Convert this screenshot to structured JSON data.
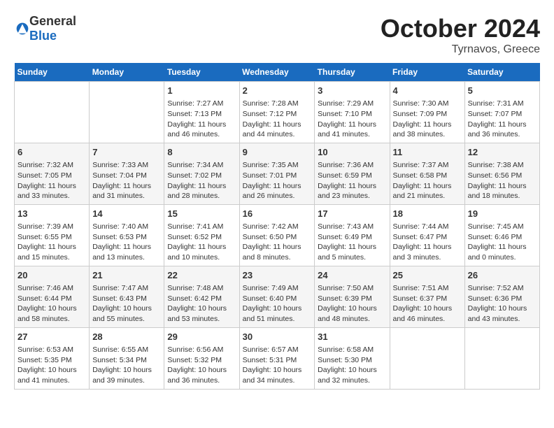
{
  "header": {
    "logo_general": "General",
    "logo_blue": "Blue",
    "month": "October 2024",
    "location": "Tyrnavos, Greece"
  },
  "weekdays": [
    "Sunday",
    "Monday",
    "Tuesday",
    "Wednesday",
    "Thursday",
    "Friday",
    "Saturday"
  ],
  "weeks": [
    [
      {
        "day": "",
        "info": ""
      },
      {
        "day": "",
        "info": ""
      },
      {
        "day": "1",
        "info": "Sunrise: 7:27 AM\nSunset: 7:13 PM\nDaylight: 11 hours and 46 minutes."
      },
      {
        "day": "2",
        "info": "Sunrise: 7:28 AM\nSunset: 7:12 PM\nDaylight: 11 hours and 44 minutes."
      },
      {
        "day": "3",
        "info": "Sunrise: 7:29 AM\nSunset: 7:10 PM\nDaylight: 11 hours and 41 minutes."
      },
      {
        "day": "4",
        "info": "Sunrise: 7:30 AM\nSunset: 7:09 PM\nDaylight: 11 hours and 38 minutes."
      },
      {
        "day": "5",
        "info": "Sunrise: 7:31 AM\nSunset: 7:07 PM\nDaylight: 11 hours and 36 minutes."
      }
    ],
    [
      {
        "day": "6",
        "info": "Sunrise: 7:32 AM\nSunset: 7:05 PM\nDaylight: 11 hours and 33 minutes."
      },
      {
        "day": "7",
        "info": "Sunrise: 7:33 AM\nSunset: 7:04 PM\nDaylight: 11 hours and 31 minutes."
      },
      {
        "day": "8",
        "info": "Sunrise: 7:34 AM\nSunset: 7:02 PM\nDaylight: 11 hours and 28 minutes."
      },
      {
        "day": "9",
        "info": "Sunrise: 7:35 AM\nSunset: 7:01 PM\nDaylight: 11 hours and 26 minutes."
      },
      {
        "day": "10",
        "info": "Sunrise: 7:36 AM\nSunset: 6:59 PM\nDaylight: 11 hours and 23 minutes."
      },
      {
        "day": "11",
        "info": "Sunrise: 7:37 AM\nSunset: 6:58 PM\nDaylight: 11 hours and 21 minutes."
      },
      {
        "day": "12",
        "info": "Sunrise: 7:38 AM\nSunset: 6:56 PM\nDaylight: 11 hours and 18 minutes."
      }
    ],
    [
      {
        "day": "13",
        "info": "Sunrise: 7:39 AM\nSunset: 6:55 PM\nDaylight: 11 hours and 15 minutes."
      },
      {
        "day": "14",
        "info": "Sunrise: 7:40 AM\nSunset: 6:53 PM\nDaylight: 11 hours and 13 minutes."
      },
      {
        "day": "15",
        "info": "Sunrise: 7:41 AM\nSunset: 6:52 PM\nDaylight: 11 hours and 10 minutes."
      },
      {
        "day": "16",
        "info": "Sunrise: 7:42 AM\nSunset: 6:50 PM\nDaylight: 11 hours and 8 minutes."
      },
      {
        "day": "17",
        "info": "Sunrise: 7:43 AM\nSunset: 6:49 PM\nDaylight: 11 hours and 5 minutes."
      },
      {
        "day": "18",
        "info": "Sunrise: 7:44 AM\nSunset: 6:47 PM\nDaylight: 11 hours and 3 minutes."
      },
      {
        "day": "19",
        "info": "Sunrise: 7:45 AM\nSunset: 6:46 PM\nDaylight: 11 hours and 0 minutes."
      }
    ],
    [
      {
        "day": "20",
        "info": "Sunrise: 7:46 AM\nSunset: 6:44 PM\nDaylight: 10 hours and 58 minutes."
      },
      {
        "day": "21",
        "info": "Sunrise: 7:47 AM\nSunset: 6:43 PM\nDaylight: 10 hours and 55 minutes."
      },
      {
        "day": "22",
        "info": "Sunrise: 7:48 AM\nSunset: 6:42 PM\nDaylight: 10 hours and 53 minutes."
      },
      {
        "day": "23",
        "info": "Sunrise: 7:49 AM\nSunset: 6:40 PM\nDaylight: 10 hours and 51 minutes."
      },
      {
        "day": "24",
        "info": "Sunrise: 7:50 AM\nSunset: 6:39 PM\nDaylight: 10 hours and 48 minutes."
      },
      {
        "day": "25",
        "info": "Sunrise: 7:51 AM\nSunset: 6:37 PM\nDaylight: 10 hours and 46 minutes."
      },
      {
        "day": "26",
        "info": "Sunrise: 7:52 AM\nSunset: 6:36 PM\nDaylight: 10 hours and 43 minutes."
      }
    ],
    [
      {
        "day": "27",
        "info": "Sunrise: 6:53 AM\nSunset: 5:35 PM\nDaylight: 10 hours and 41 minutes."
      },
      {
        "day": "28",
        "info": "Sunrise: 6:55 AM\nSunset: 5:34 PM\nDaylight: 10 hours and 39 minutes."
      },
      {
        "day": "29",
        "info": "Sunrise: 6:56 AM\nSunset: 5:32 PM\nDaylight: 10 hours and 36 minutes."
      },
      {
        "day": "30",
        "info": "Sunrise: 6:57 AM\nSunset: 5:31 PM\nDaylight: 10 hours and 34 minutes."
      },
      {
        "day": "31",
        "info": "Sunrise: 6:58 AM\nSunset: 5:30 PM\nDaylight: 10 hours and 32 minutes."
      },
      {
        "day": "",
        "info": ""
      },
      {
        "day": "",
        "info": ""
      }
    ]
  ]
}
